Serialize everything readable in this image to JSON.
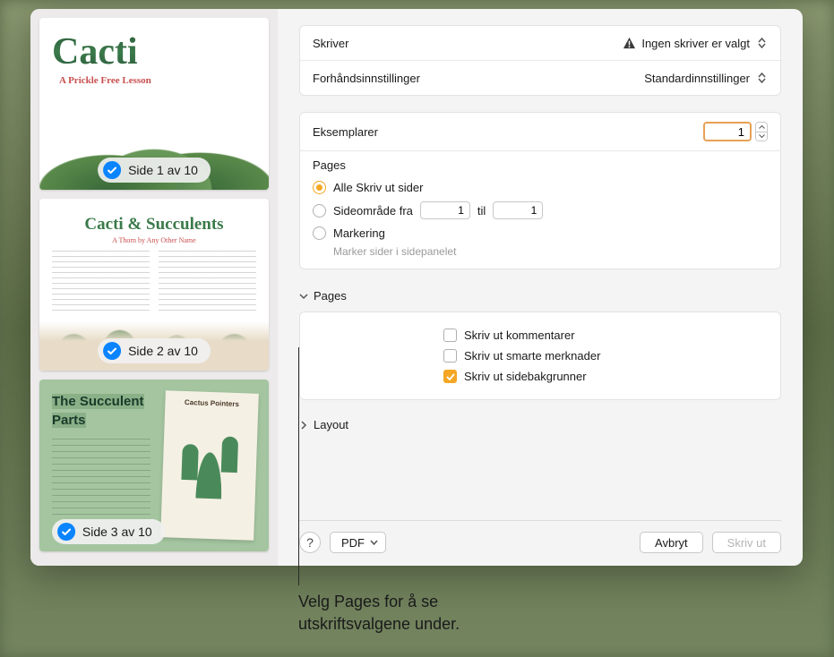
{
  "sidebar": {
    "thumbs": [
      {
        "badge": "Side 1 av 10",
        "title": "Cacti",
        "subtitle": "A Prickle Free Lesson"
      },
      {
        "badge": "Side 2 av 10",
        "title": "Cacti & Succulents",
        "subtitle": "A Thorn by Any Other Name"
      },
      {
        "badge": "Side 3 av 10",
        "title_left": "The Succulent Parts",
        "title_right": "Cactus Pointers"
      }
    ]
  },
  "printer": {
    "label": "Skriver",
    "value": "Ingen skriver er valgt"
  },
  "presets": {
    "label": "Forhåndsinnstillinger",
    "value": "Standardinnstillinger"
  },
  "copies": {
    "label": "Eksemplarer",
    "value": "1"
  },
  "pages": {
    "heading": "Pages",
    "all": "Alle Skriv ut sider",
    "range_from": "Sideområde fra",
    "range_to": "til",
    "from_value": "1",
    "to_value": "1",
    "selection": "Markering",
    "hint": "Marker sider i sidepanelet"
  },
  "appSection": {
    "title": "Pages",
    "opts": {
      "comments": "Skriv ut kommentarer",
      "annotations": "Skriv ut smarte merknader",
      "backgrounds": "Skriv ut sidebakgrunner"
    }
  },
  "layoutSection": "Layout",
  "footer": {
    "help": "?",
    "pdf": "PDF",
    "cancel": "Avbryt",
    "print": "Skriv ut"
  },
  "callout": {
    "line1": "Velg Pages for å se",
    "line2": "utskriftsvalgene under."
  }
}
